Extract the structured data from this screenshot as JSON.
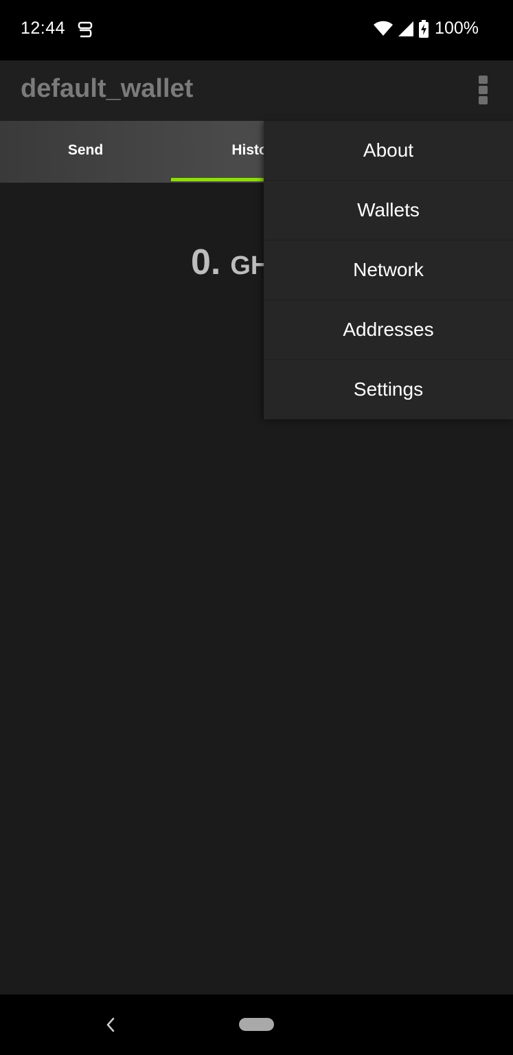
{
  "status_bar": {
    "time": "12:44",
    "app_icon": "notification-app-icon",
    "battery": "100%",
    "icons": [
      "wifi-icon",
      "signal-icon",
      "battery-charging-icon"
    ]
  },
  "app_bar": {
    "title": "default_wallet",
    "overflow_icon": "overflow-menu-icon"
  },
  "tabs": [
    {
      "label": "Send"
    },
    {
      "label": "History",
      "selected": true
    }
  ],
  "balance": {
    "amount": "0.",
    "unit": "GH"
  },
  "menu": {
    "items": [
      {
        "label": "About"
      },
      {
        "label": "Wallets"
      },
      {
        "label": "Network"
      },
      {
        "label": "Addresses"
      },
      {
        "label": "Settings"
      }
    ]
  },
  "nav_bar": {
    "back_icon": "back-icon",
    "home_icon": "home-pill-icon"
  },
  "colors": {
    "accent": "#8ee000",
    "background": "#1b1b1b",
    "menu_background": "#262626"
  }
}
